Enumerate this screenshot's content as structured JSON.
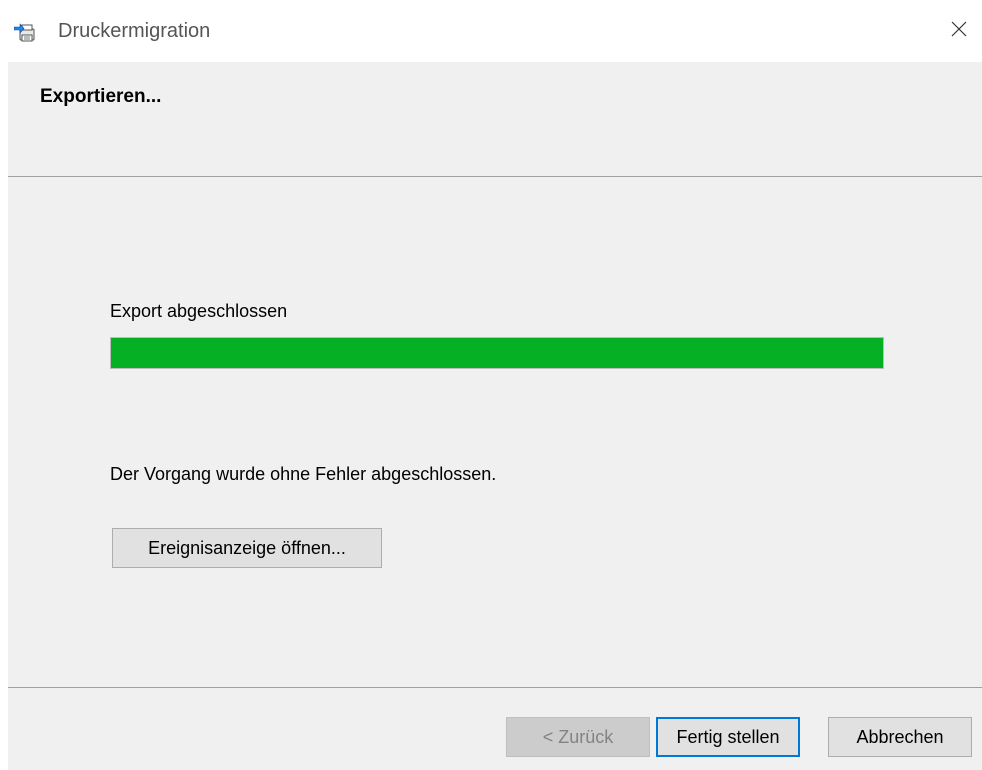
{
  "window": {
    "title": "Druckermigration",
    "app_icon": "printer-migration-icon",
    "close_icon": "close-icon"
  },
  "header": {
    "title": "Exportieren..."
  },
  "content": {
    "status_label": "Export abgeschlossen",
    "progress_percent": 100,
    "progress_color": "#06b025",
    "result_message": "Der Vorgang wurde ohne Fehler abgeschlossen.",
    "event_viewer_button": "Ereignisanzeige öffnen..."
  },
  "footer": {
    "back_button": "< Zurück",
    "finish_button": "Fertig stellen",
    "cancel_button": "Abbrechen"
  }
}
